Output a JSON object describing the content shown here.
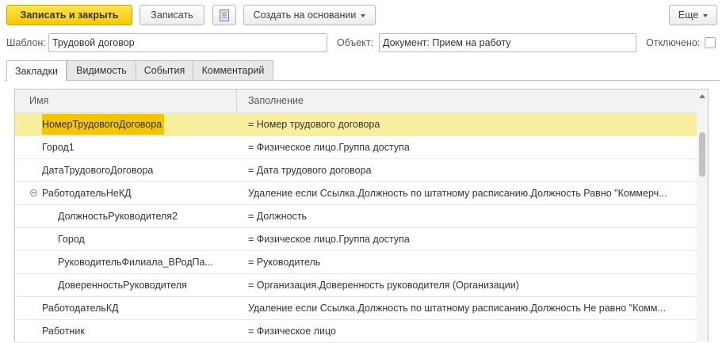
{
  "toolbar": {
    "save_close": "Записать и закрыть",
    "save": "Записать",
    "create_based_on": "Создать на основании",
    "more": "Еще",
    "report_icon": "document-icon"
  },
  "form": {
    "template_label": "Шаблон:",
    "template_value": "Трудовой договор",
    "object_label": "Объект:",
    "object_value": "Документ: Прием на работу",
    "disabled_label": "Отключено:",
    "disabled_checked": false
  },
  "tabs": [
    "Закладки",
    "Видимость",
    "События",
    "Комментарий"
  ],
  "active_tab": "Закладки",
  "table": {
    "columns": [
      "Имя",
      "Заполнение"
    ],
    "rows": [
      {
        "name": "НомерТрудовогоДоговора",
        "fill": "= Номер трудового договора"
      },
      {
        "name": "Город1",
        "fill": "= Физическое лицо.Группа доступа"
      },
      {
        "name": "ДатаТрудовогоДоговора",
        "fill": "= Дата трудового договора"
      },
      {
        "name": "РаботодательНеКД",
        "fill": "Удаление если Ссылка.Должность по штатному расписанию.Должность Равно \"Коммерч..."
      },
      {
        "name": "ДолжностьРуководителя2",
        "fill": "= Должность"
      },
      {
        "name": "Город",
        "fill": "= Физическое лицо.Группа доступа"
      },
      {
        "name": "РуководительФилиала_ВРодПа...",
        "fill": "= Руководитель"
      },
      {
        "name": "ДоверенностьРуководителя",
        "fill": "= Организация.Доверенность руководителя (Организации)"
      },
      {
        "name": "РаботодательКД",
        "fill": "Удаление если Ссылка.Должность по штатному расписанию.Должность Не равно \"Комм..."
      },
      {
        "name": "Работник",
        "fill": "= Физическое лицо"
      }
    ]
  },
  "colors": {
    "primary_button": "#f5c900",
    "selected_row": "#f9ed9e",
    "selected_name": "#f2c500"
  }
}
